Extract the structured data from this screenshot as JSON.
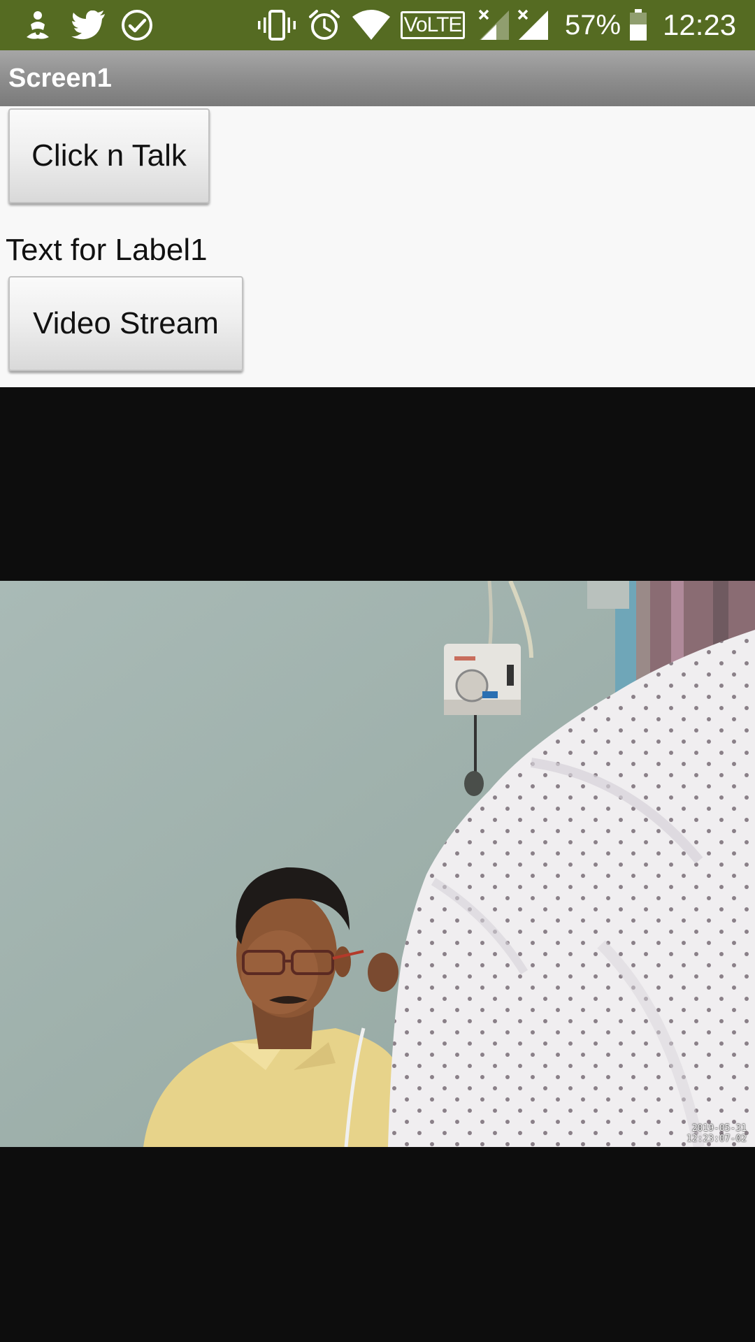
{
  "status_bar": {
    "notification_icons": [
      "app-notification-icon",
      "twitter-icon",
      "check-circle-icon"
    ],
    "system_icons": [
      "vibrate-icon",
      "alarm-icon",
      "wifi-icon",
      "volte-icon",
      "signal-icon-sim1",
      "signal-icon-sim2",
      "battery-icon"
    ],
    "volte_label": "VoLTE",
    "battery_percent": "57%",
    "battery_level": 0.57,
    "time": "12:23",
    "color": "#556b22"
  },
  "title_bar": {
    "title": "Screen1"
  },
  "content": {
    "click_talk_button": "Click n Talk",
    "label1": "Text for Label1",
    "video_stream_button": "Video Stream"
  },
  "video": {
    "timestamp_date": "2019-05-31",
    "timestamp_time": "12:23:07-02"
  }
}
